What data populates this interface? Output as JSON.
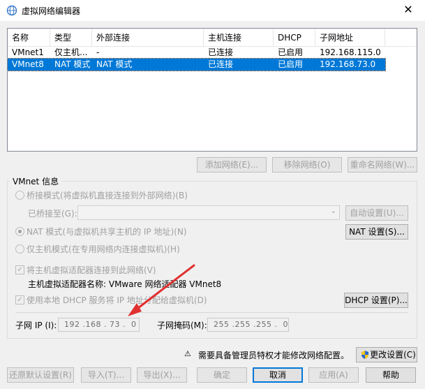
{
  "window": {
    "title": "虚拟网络编辑器",
    "close": "✕"
  },
  "table": {
    "columns": [
      "名称",
      "类型",
      "外部连接",
      "主机连接",
      "DHCP",
      "子网地址"
    ],
    "rows": [
      {
        "name": "VMnet1",
        "type": "仅主机...",
        "external": "-",
        "host": "已连接",
        "dhcp": "已启用",
        "subnet": "192.168.115.0",
        "selected": false
      },
      {
        "name": "VMnet8",
        "type": "NAT 模式",
        "external": "NAT 模式",
        "host": "已连接",
        "dhcp": "已启用",
        "subnet": "192.168.73.0",
        "selected": true
      }
    ]
  },
  "network_buttons": {
    "add": "添加网络(E)...",
    "remove": "移除网络(O)",
    "rename": "重命名网络(W)..."
  },
  "vmnet_info": {
    "title": "VMnet 信息",
    "bridged": "桥接模式(将虚拟机直接连接到外部网络)(B)",
    "bridged_to": "已桥接至(G):",
    "auto_settings": "自动设置(U)...",
    "nat": "NAT 模式(与虚拟机共享主机的 IP 地址)(N)",
    "nat_settings": "NAT 设置(S)...",
    "host_only": "仅主机模式(在专用网络内连接虚拟机)(H)",
    "connect_adapter": "将主机虚拟适配器连接到此网络(V)",
    "adapter_name_label": "主机虚拟适配器名称: VMware 网络适配器 VMnet8",
    "use_dhcp": "使用本地 DHCP 服务将 IP 地址分配给虚拟机(D)",
    "dhcp_settings": "DHCP 设置(P)...",
    "subnet_ip_label": "子网 IP (I):",
    "subnet_ip": "192 .168 . 73 .  0",
    "subnet_mask_label": "子网掩码(M):",
    "subnet_mask": "255 .255 .255 .  0"
  },
  "admin": {
    "notice": "需要具备管理员特权才能修改网络配置。",
    "change_settings": "更改设置(C)"
  },
  "footer": {
    "restore": "还原默认设置(R)",
    "import": "导入(T)...",
    "export": "导出(X)...",
    "ok": "确定",
    "cancel": "取消",
    "apply": "应用(A)",
    "help": "帮助"
  },
  "colors": {
    "selection": "#0078d7",
    "annotation_arrow": "#e03030"
  }
}
